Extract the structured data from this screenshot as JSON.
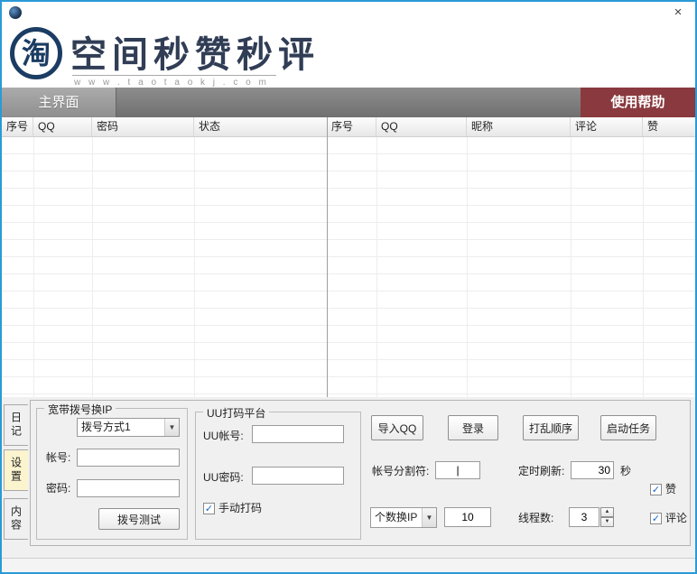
{
  "window": {
    "close_glyph": "×"
  },
  "header": {
    "logo_char": "淘",
    "title": "空间秒赞秒评",
    "url": "w w w . t a o t a o k j . c o m"
  },
  "tabbar": {
    "main_tab": "主界面",
    "help": "使用帮助"
  },
  "tables": {
    "left_headers": [
      "序号",
      "QQ",
      "密码",
      "状态"
    ],
    "right_headers": [
      "序号",
      "QQ",
      "昵称",
      "评论",
      "赞"
    ]
  },
  "side_tabs": {
    "diary": "日记",
    "settings": "设置",
    "content": "内容"
  },
  "dial": {
    "group_title": "宽带拨号换IP",
    "mode": "拨号方式1",
    "account_label": "帐号:",
    "password_label": "密码:",
    "test_button": "拨号测试"
  },
  "uu": {
    "group_title": "UU打码平台",
    "account_label": "UU帐号:",
    "password_label": "UU密码:",
    "manual_label": "手动打码"
  },
  "task": {
    "import_qq": "导入QQ",
    "login": "登录",
    "shuffle": "打乱顺序",
    "start": "启动任务",
    "separator_label": "帐号分割符:",
    "separator_value": "|",
    "refresh_label": "定时刷新:",
    "refresh_value": "30",
    "refresh_unit": "秒",
    "ip_mode": "个数换IP",
    "ip_count": "10",
    "threads_label": "线程数:",
    "threads_value": "3",
    "like_label": "赞",
    "comment_label": "评论"
  },
  "icons": {
    "dropdown_arrow": "▼",
    "spinner_up": "▲",
    "spinner_down": "▼",
    "check": "✓"
  }
}
